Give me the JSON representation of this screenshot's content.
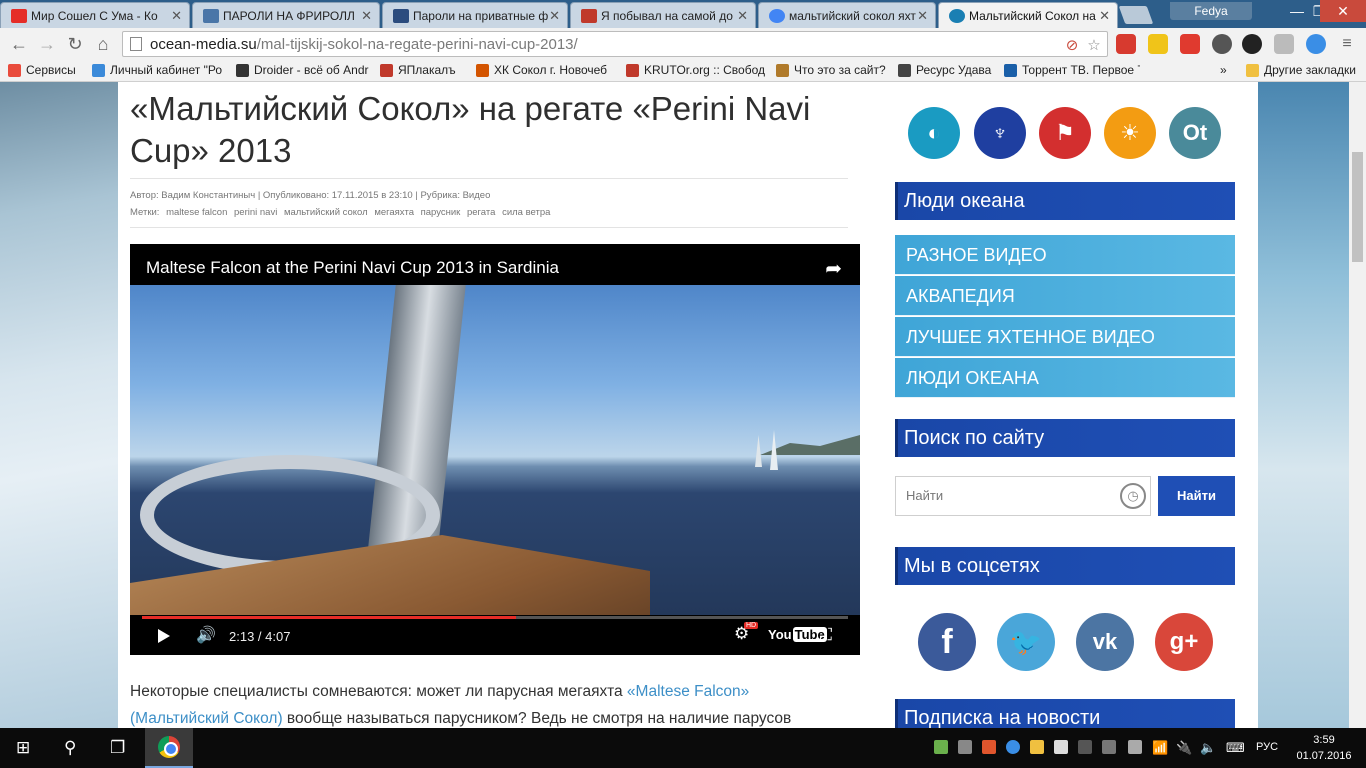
{
  "browser": {
    "tabs": [
      {
        "label": "Мир Сошел С Ума - Ко",
        "fav_color": "#e52d27"
      },
      {
        "label": "ПАРОЛИ НА ФРИРОЛЛ",
        "fav_color": "#4a76a8"
      },
      {
        "label": "Пароли на приватные ф",
        "fav_color": "#2b4c7e"
      },
      {
        "label": "Я побывал на самой до",
        "fav_color": "#c0392b"
      },
      {
        "label": "мальтийский сокол яхт",
        "fav_color": "#4285f4"
      },
      {
        "label": "Мальтийский Сокол на",
        "fav_color": "#1a7fb3",
        "active": true
      }
    ],
    "profile_name": "Fedya",
    "window_controls": {
      "minimize": "—",
      "restore": "❐",
      "close": "✕"
    },
    "url_host": "ocean-media.su",
    "url_path": "/mal-tijskij-sokol-na-regate-perini-navi-cup-2013/",
    "bookmarks": [
      {
        "label": "Сервисы",
        "color": "#e94b3c"
      },
      {
        "label": "Личный кабинет \"Ро",
        "color": "#3b8ad9"
      },
      {
        "label": "Droider - всё об Andr",
        "color": "#333333"
      },
      {
        "label": "ЯПлакалъ",
        "color": "#c0392b"
      },
      {
        "label": "ХК Сокол г. Новочеб",
        "color": "#d35400"
      },
      {
        "label": "KRUTOr.org :: Свобод",
        "color": "#c0392b"
      },
      {
        "label": "Что это за сайт?",
        "color": "#b07a2a"
      },
      {
        "label": "Ресурс Удава",
        "color": "#444444"
      },
      {
        "label": "Торрент ТВ. Первое Т",
        "color": "#1a5fa8"
      }
    ],
    "other_bookmarks": "Другие закладки"
  },
  "article": {
    "title": "«Мальтийский Сокол» на регате «Perini Navi Cup» 2013",
    "meta_line": "Автор: Вадим Константиныч | Опубликовано: 17.11.2015 в 23:10 | Рубрика: Видео",
    "tags_label": "Метки:",
    "tags": [
      "maltese falcon",
      "perini navi",
      "мальтийский сокол",
      "мегаяхта",
      "парусник",
      "регата",
      "сила ветра"
    ],
    "body_prefix": "Некоторые специалисты сомневаются: может ли парусная мегаяхта ",
    "link1": "«Maltese Falcon»",
    "link2": "(Мальтийский Сокол)",
    "body_suffix": " вообще называться парусником? Ведь не смотря на наличие парусов"
  },
  "video": {
    "title": "Maltese Falcon at the Perini Navi Cup 2013 in Sardinia",
    "time": "2:13 / 4:07",
    "progress": 0.53,
    "hd_badge": "HD",
    "youtube_label": "You",
    "youtube_tube": "Tube"
  },
  "sidebar": {
    "partner_icons": [
      {
        "name": "ocean-media-logo-icon",
        "color": "#1a9bc2",
        "glyph": "◐"
      },
      {
        "name": "cup-logo-icon",
        "color": "#1f3fa0",
        "glyph": "♆"
      },
      {
        "name": "flag-logo-icon",
        "color": "#d32f2f",
        "glyph": "⚑"
      },
      {
        "name": "ocean-fan-logo-icon",
        "color": "#f39c12",
        "glyph": "☀"
      },
      {
        "name": "ot-logo-icon",
        "color": "#4a8a9a",
        "glyph": "Ot"
      }
    ],
    "widget_people": "Люди океана",
    "categories": [
      "РАЗНОЕ ВИДЕО",
      "АКВАПЕДИЯ",
      "ЛУЧШЕЕ ЯХТЕННОЕ ВИДЕО",
      "ЛЮДИ ОКЕАНА"
    ],
    "widget_search": "Поиск по сайту",
    "search_placeholder": "Найти",
    "search_button": "Найти",
    "widget_social": "Мы в соцсетях",
    "social": [
      {
        "name": "facebook-icon",
        "label": "f",
        "color": "#3b5a9a"
      },
      {
        "name": "twitter-icon",
        "label": "🐦",
        "color": "#4aa6d9"
      },
      {
        "name": "vk-icon",
        "label": "vk",
        "color": "#4c75a3"
      },
      {
        "name": "google-plus-icon",
        "label": "g+",
        "color": "#d9473a"
      }
    ],
    "widget_subscribe": "Подписка на новости"
  },
  "taskbar": {
    "language": "РУС",
    "time": "3:59",
    "date": "01.07.2016"
  }
}
